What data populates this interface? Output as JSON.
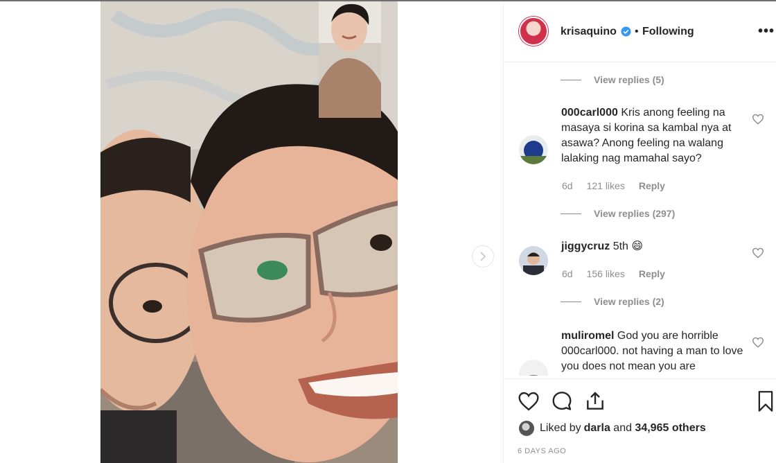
{
  "post": {
    "username": "krisaquino",
    "follow_status": "Following",
    "separator": "•",
    "more_label": "•••"
  },
  "comments": [
    {
      "view_replies": "View replies (5)"
    },
    {
      "username": "000carl000",
      "text": "Kris anong feeling na masaya si korina sa kambal nya at asawa? Anong feeling na walang lalaking nag mamahal sayo?",
      "age": "6d",
      "likes": "121 likes",
      "reply": "Reply",
      "view_replies": "View replies (297)"
    },
    {
      "username": "jiggycruz",
      "text": "5th 😄",
      "age": "6d",
      "likes": "156 likes",
      "reply": "Reply",
      "view_replies": "View replies (2)"
    },
    {
      "username": "muliromel",
      "text": "God you are horrible 000carl000. not having a man to love you does not mean you are"
    }
  ],
  "footer": {
    "liked_by_prefix": "Liked by ",
    "liked_by_user": "darla",
    "liked_by_middle": " and ",
    "liked_by_count": "34,965 others",
    "date": "6 DAYS AGO"
  },
  "icons": {
    "verified": "verified-badge-icon",
    "heart": "heart-icon",
    "comment": "comment-icon",
    "share": "share-icon",
    "bookmark": "bookmark-icon",
    "next": "chevron-right-icon"
  },
  "colors": {
    "verified_blue": "#3897f0",
    "muted_text": "#8e8e8e",
    "text": "#262626"
  }
}
